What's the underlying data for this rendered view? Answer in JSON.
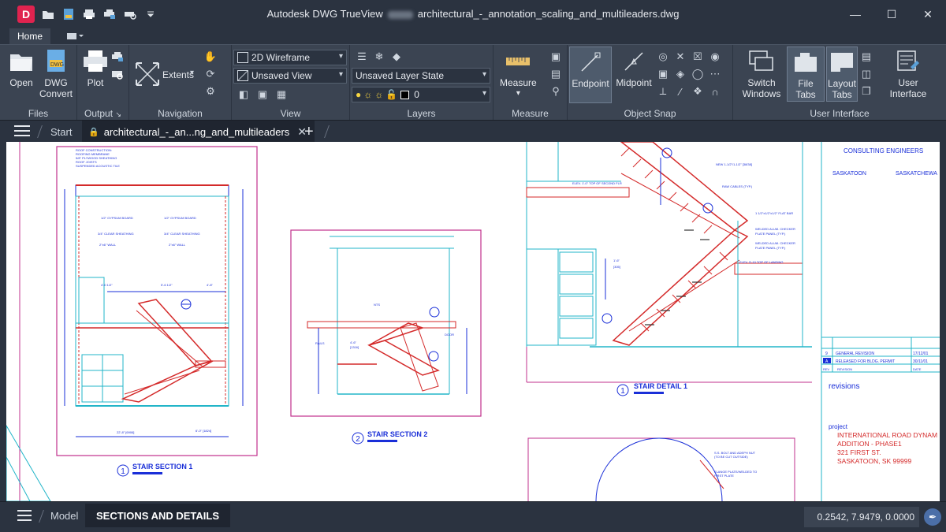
{
  "window": {
    "app_name": "Autodesk DWG TrueView",
    "file_name": "architectural_-_annotation_scaling_and_multileaders.dwg",
    "app_logo_letter": "D"
  },
  "ribbon": {
    "active_tab": "Home",
    "panels": {
      "files": {
        "title": "Files",
        "open": "Open",
        "dwg_convert_1": "DWG",
        "dwg_convert_2": "Convert"
      },
      "output": {
        "title": "Output",
        "plot": "Plot"
      },
      "navigation": {
        "title": "Navigation",
        "extents": "Extents"
      },
      "view": {
        "title": "View",
        "visual_style": "2D Wireframe",
        "named_view": "Unsaved View"
      },
      "layers": {
        "title": "Layers",
        "layer_state": "Unsaved Layer State",
        "current_layer": "0"
      },
      "measure": {
        "title": "Measure",
        "measure": "Measure"
      },
      "object_snap": {
        "title": "Object Snap",
        "endpoint": "Endpoint",
        "midpoint": "Midpoint"
      },
      "user_interface": {
        "title": "User Interface",
        "switch_windows_1": "Switch",
        "switch_windows_2": "Windows",
        "file_tabs": "File Tabs",
        "layout_tabs_1": "Layout",
        "layout_tabs_2": "Tabs",
        "user_interface_1": "User",
        "user_interface_2": "Interface"
      }
    }
  },
  "doc_tabs": {
    "start": "Start",
    "active": "architectural_-_an...ng_and_multileaders"
  },
  "drawing": {
    "title_block": {
      "firm": "CONSULTING  ENGINEERS",
      "city1": "SASKATOON",
      "city2": "SASKATCHEWA",
      "revisions_label": "revisions",
      "rev_rows": [
        {
          "num": "9",
          "desc": "GENERAL REVISION",
          "date": "17/12/01"
        },
        {
          "num": "A",
          "desc": "RELEASED FOR BLDG. PERMIT",
          "date": "30/11/01"
        }
      ],
      "rev_header": {
        "num": "REV",
        "desc": "REVISION",
        "date": "DATE"
      },
      "project_label": "project",
      "project_lines": [
        "INTERNATIONAL ROAD DYNAM",
        "ADDITION - PHASE1",
        "321 FIRST ST.",
        "SASKATOON,  SK  99999"
      ]
    },
    "views": [
      {
        "num": "1",
        "title": "STAIR SECTION 1"
      },
      {
        "num": "2",
        "title": "STAIR SECTION 2"
      },
      {
        "num": "1",
        "title": "STAIR DETAIL 1"
      }
    ]
  },
  "status": {
    "model_tab": "Model",
    "layout_tab": "SECTIONS AND DETAILS",
    "coordinates": "0.2542, 7.9479, 0.0000"
  },
  "colors": {
    "ui_dark": "#2b3340",
    "ui_panel": "#3b4452",
    "accent_red": "#e0234f",
    "drawing_red": "#d42a2a",
    "drawing_magenta": "#c0308c",
    "drawing_cyan": "#22b5c8",
    "drawing_blue": "#1a2fd8"
  }
}
